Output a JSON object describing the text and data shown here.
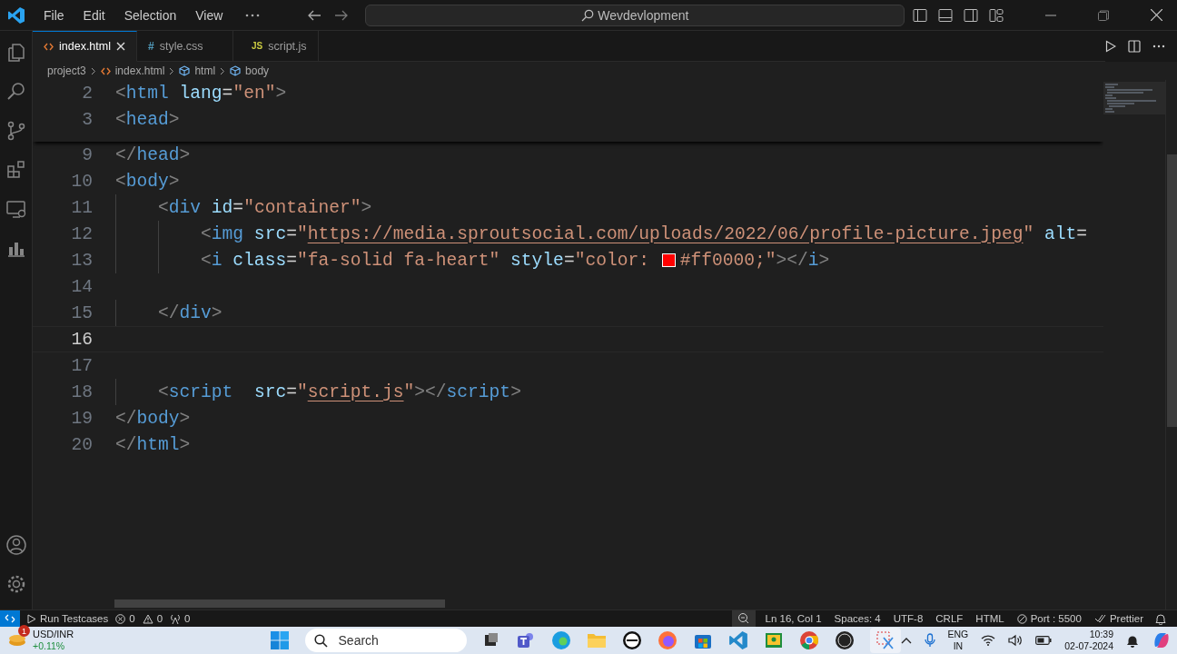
{
  "menu": [
    "File",
    "Edit",
    "Selection",
    "View"
  ],
  "command_center": {
    "text": "Wevdevlopment"
  },
  "tabs": [
    {
      "label": "index.html",
      "kind": "html",
      "selected": true
    },
    {
      "label": "style.css",
      "kind": "css",
      "badge": "#",
      "selected": false
    },
    {
      "label": "script.js",
      "kind": "js",
      "badge": "JS",
      "selected": false
    }
  ],
  "breadcrumbs": [
    {
      "label": "project3",
      "kind": "folder"
    },
    {
      "label": "index.html",
      "kind": "html"
    },
    {
      "label": "html",
      "kind": "element"
    },
    {
      "label": "body",
      "kind": "element"
    }
  ],
  "sticky_lines": [
    {
      "number": "2",
      "selected": false,
      "tokens": [
        {
          "kind": "tag",
          "text": "<"
        },
        {
          "kind": "name",
          "text": "html"
        },
        {
          "kind": "attr",
          "text": " lang"
        },
        {
          "kind": "plain",
          "text": "="
        },
        {
          "kind": "str",
          "text": "\"en\""
        },
        {
          "kind": "tag",
          "text": ">"
        }
      ]
    },
    {
      "number": "3",
      "selected": false,
      "tokens": [
        {
          "kind": "tag",
          "text": "<"
        },
        {
          "kind": "name",
          "text": "head"
        },
        {
          "kind": "tag",
          "text": ">"
        }
      ]
    }
  ],
  "lines": [
    {
      "number": "9",
      "selected": false,
      "tokens": [
        {
          "kind": "tag",
          "text": "</"
        },
        {
          "kind": "name",
          "text": "head"
        },
        {
          "kind": "tag",
          "text": ">"
        }
      ]
    },
    {
      "number": "10",
      "selected": false,
      "tokens": [
        {
          "kind": "tag",
          "text": "<"
        },
        {
          "kind": "name",
          "text": "body"
        },
        {
          "kind": "tag",
          "text": ">"
        }
      ]
    },
    {
      "number": "11",
      "selected": false,
      "tokens": [
        {
          "kind": "tag",
          "text": "    <"
        },
        {
          "kind": "name",
          "text": "div"
        },
        {
          "kind": "attr",
          "text": " id"
        },
        {
          "kind": "plain",
          "text": "="
        },
        {
          "kind": "str",
          "text": "\"container\""
        },
        {
          "kind": "tag",
          "text": ">"
        }
      ]
    },
    {
      "number": "12",
      "selected": false,
      "tokens": [
        {
          "kind": "tag",
          "text": "        <"
        },
        {
          "kind": "name",
          "text": "img"
        },
        {
          "kind": "attr",
          "text": " src"
        },
        {
          "kind": "plain",
          "text": "="
        },
        {
          "kind": "str",
          "text": "\""
        },
        {
          "kind": "link",
          "text": "https://media.sproutsocial.com/uploads/2022/06/profile-picture.jpeg"
        },
        {
          "kind": "str",
          "text": "\""
        },
        {
          "kind": "attr",
          "text": " alt"
        },
        {
          "kind": "plain",
          "text": "="
        }
      ]
    },
    {
      "number": "13",
      "selected": false,
      "tokens": [
        {
          "kind": "tag",
          "text": "        <"
        },
        {
          "kind": "name",
          "text": "i"
        },
        {
          "kind": "attr",
          "text": " class"
        },
        {
          "kind": "plain",
          "text": "="
        },
        {
          "kind": "str",
          "text": "\"fa-solid fa-heart\""
        },
        {
          "kind": "attr",
          "text": " style"
        },
        {
          "kind": "plain",
          "text": "="
        },
        {
          "kind": "str",
          "text": "\"color: "
        },
        {
          "kind": "swatch",
          "color": "#ff0000"
        },
        {
          "kind": "str",
          "text": "#ff0000;\""
        },
        {
          "kind": "tag",
          "text": "></"
        },
        {
          "kind": "name",
          "text": "i"
        },
        {
          "kind": "tag",
          "text": ">"
        }
      ]
    },
    {
      "number": "14",
      "selected": false
    },
    {
      "number": "15",
      "selected": false,
      "tokens": [
        {
          "kind": "tag",
          "text": "    </"
        },
        {
          "kind": "name",
          "text": "div"
        },
        {
          "kind": "tag",
          "text": ">"
        }
      ]
    },
    {
      "number": "16",
      "selected": true
    },
    {
      "number": "17",
      "selected": false
    },
    {
      "number": "18",
      "selected": false,
      "tokens": [
        {
          "kind": "tag",
          "text": "    <"
        },
        {
          "kind": "name",
          "text": "script"
        },
        {
          "kind": "attr",
          "text": "  src"
        },
        {
          "kind": "plain",
          "text": "="
        },
        {
          "kind": "str",
          "text": "\""
        },
        {
          "kind": "link",
          "text": "script.js"
        },
        {
          "kind": "str",
          "text": "\""
        },
        {
          "kind": "tag",
          "text": "></"
        },
        {
          "kind": "name",
          "text": "script"
        },
        {
          "kind": "tag",
          "text": ">"
        }
      ]
    },
    {
      "number": "19",
      "selected": false,
      "tokens": [
        {
          "kind": "tag",
          "text": "</"
        },
        {
          "kind": "name",
          "text": "body"
        },
        {
          "kind": "tag",
          "text": ">"
        }
      ]
    },
    {
      "number": "20",
      "selected": false,
      "tokens": [
        {
          "kind": "tag",
          "text": "</"
        },
        {
          "kind": "name",
          "text": "html"
        },
        {
          "kind": "tag",
          "text": ">"
        }
      ]
    }
  ],
  "status_bar": {
    "left": [
      {
        "kind": "run",
        "text": "Run Testcases"
      },
      {
        "kind": "errors",
        "text": "0"
      },
      {
        "kind": "warnings",
        "text": "0"
      },
      {
        "kind": "ports",
        "text": "0"
      }
    ],
    "right": [
      {
        "kind": "plain",
        "text": "Ln 16, Col 1"
      },
      {
        "kind": "plain",
        "text": "Spaces: 4"
      },
      {
        "kind": "plain",
        "text": "UTF-8"
      },
      {
        "kind": "plain",
        "text": "CRLF"
      },
      {
        "kind": "plain",
        "text": "HTML"
      },
      {
        "kind": "port",
        "text": "Port : 5500"
      },
      {
        "kind": "prettier",
        "text": "Prettier"
      }
    ]
  },
  "taskbar": {
    "widget": {
      "badge": "1",
      "title": "USD/INR",
      "change": "+0.11%"
    },
    "search": {
      "placeholder": "Search"
    },
    "language": [
      "ENG",
      "IN"
    ],
    "time": "10:39",
    "date": "02-07-2024"
  }
}
